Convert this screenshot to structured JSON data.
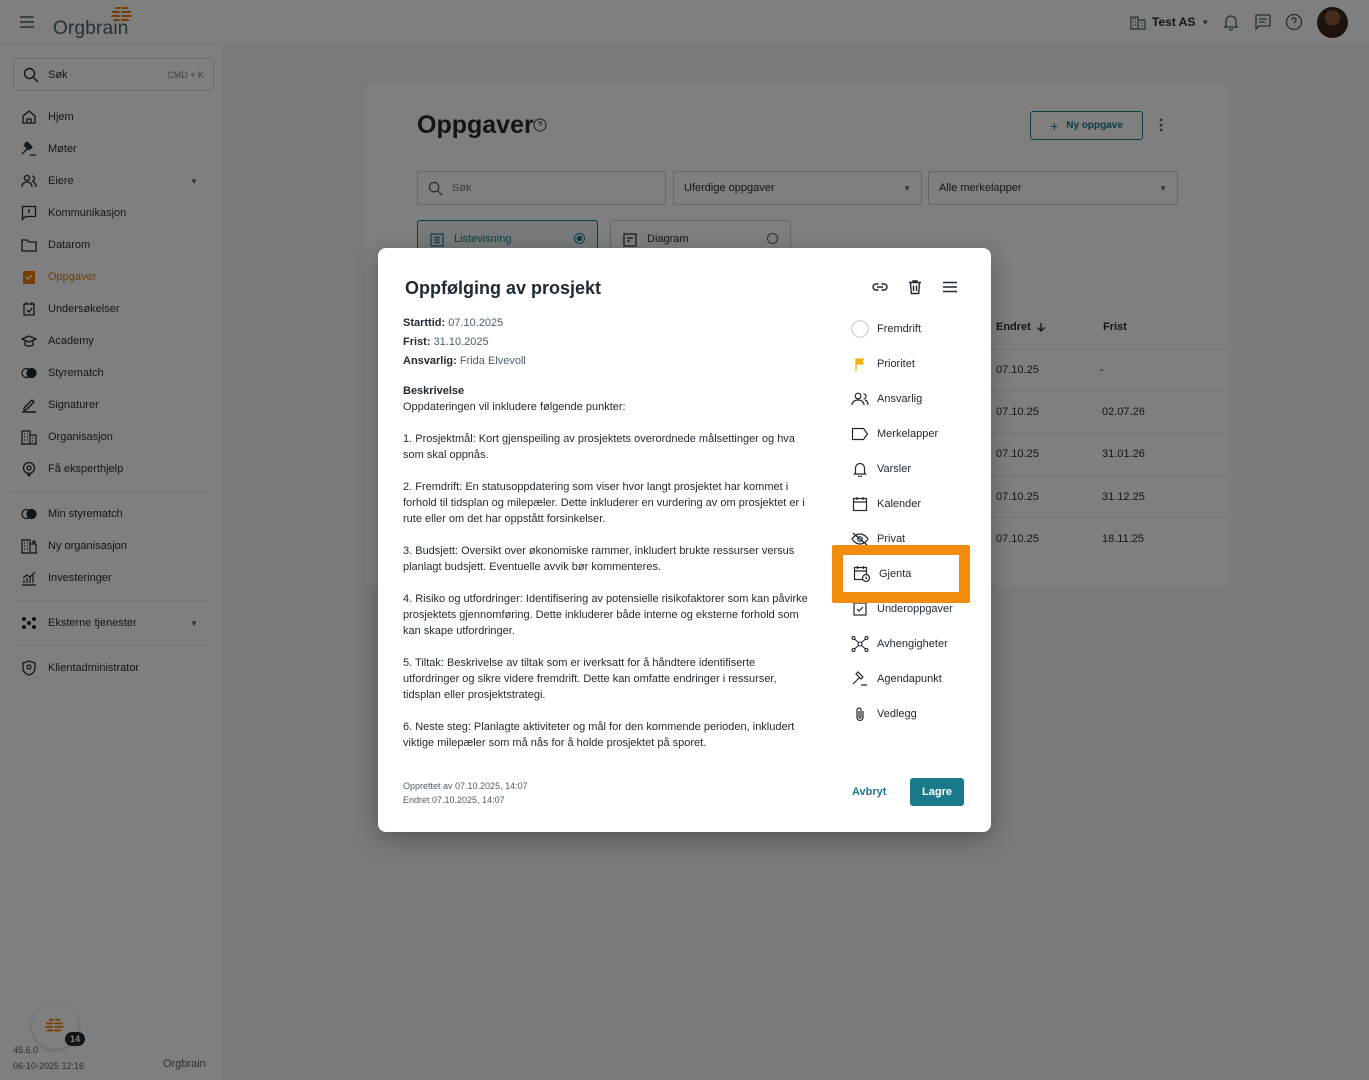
{
  "app": {
    "logo_text": "Orgbrain",
    "company": "Test AS"
  },
  "sidebar": {
    "search_label": "Søk",
    "search_shortcut": "CMD + K",
    "items": [
      {
        "label": "Hjem",
        "icon": "home-icon"
      },
      {
        "label": "Møter",
        "icon": "gavel-icon"
      },
      {
        "label": "Eiere",
        "icon": "people-icon"
      },
      {
        "label": "Kommunikasjon",
        "icon": "chat-icon"
      },
      {
        "label": "Datarom",
        "icon": "folder-icon"
      },
      {
        "label": "Oppgaver",
        "icon": "task-icon"
      },
      {
        "label": "Undersøkelser",
        "icon": "survey-icon"
      },
      {
        "label": "Academy",
        "icon": "academy-icon"
      },
      {
        "label": "Styrematch",
        "icon": "match-icon"
      },
      {
        "label": "Signaturer",
        "icon": "pen-icon"
      },
      {
        "label": "Organisasjon",
        "icon": "building-icon"
      },
      {
        "label": "Få eksperthjelp",
        "icon": "expert-icon"
      }
    ],
    "items2": [
      {
        "label": "Min styrematch",
        "icon": "match-icon"
      },
      {
        "label": "Ny organisasjon",
        "icon": "building-icon"
      },
      {
        "label": "Investeringer",
        "icon": "chart-icon"
      }
    ],
    "external": "Eksterne tjenester",
    "admin": "Klientadministrator",
    "badge_count": "14",
    "version": "45.6.0",
    "version_date": "06-10-2025 12:16",
    "footer_logo": "Orgbrain"
  },
  "page": {
    "title": "Oppgaver",
    "new_button": "Ny oppgave",
    "search_placeholder": "Søk",
    "filter_status": "Uferdige oppgaver",
    "filter_tags": "Alle merkelapper",
    "view_list": "Listevisning",
    "view_diagram": "Diagram",
    "col_changed": "Endret",
    "col_due": "Frist",
    "rows": [
      {
        "changed": "07.10.25",
        "due": "-"
      },
      {
        "changed": "07.10.25",
        "due": "02.07.26"
      },
      {
        "changed": "07.10.25",
        "due": "31.01.26"
      },
      {
        "changed": "07.10.25",
        "due": "31.12.25"
      },
      {
        "changed": "07.10.25",
        "due": "18.11.25"
      }
    ]
  },
  "dialog": {
    "title": "Oppfølging av prosjekt",
    "start_label": "Starttid:",
    "start_value": "07.10.2025",
    "due_label": "Frist:",
    "due_value": "31.10.2025",
    "resp_label": "Ansvarlig:",
    "resp_value": "Frida Elvevoll",
    "desc_heading": "Beskrivelse",
    "desc_intro": "Oppdateringen vil inkludere følgende punkter:",
    "desc_points": [
      "1. Prosjektmål: Kort gjenspeiling av prosjektets overordnede målsettinger og hva som skal oppnås.",
      "2. Fremdrift: En statusoppdatering som viser hvor langt prosjektet har kommet i forhold til tidsplan og milepæler. Dette inkluderer en vurdering av om prosjektet er i rute eller om det har oppstått forsinkelser.",
      "3. Budsjett: Oversikt over økonomiske rammer, inkludert brukte ressurser versus planlagt budsjett. Eventuelle avvik bør kommenteres.",
      "4. Risiko og utfordringer: Identifisering av potensielle risikofaktorer som kan påvirke prosjektets gjennomføring. Dette inkluderer både interne og eksterne forhold som kan skape utfordringer.",
      "5. Tiltak: Beskrivelse av tiltak som er iverksatt for å håndtere identifiserte utfordringer og sikre videre fremdrift. Dette kan omfatte endringer i ressurser, tidsplan eller prosjektstrategi.",
      "6. Neste steg: Planlagte aktiviteter og mål for den kommende perioden, inkludert viktige milepæler som må nås for å holde prosjektet på sporet."
    ],
    "created": "Opprettet av 07.10.2025, 14:07",
    "changed": "Endret 07.10.2025, 14:07",
    "side_items": [
      {
        "label": "Fremdrift",
        "icon": "progress-circle-icon"
      },
      {
        "label": "Prioritet",
        "icon": "flag-icon"
      },
      {
        "label": "Ansvarlig",
        "icon": "people-icon"
      },
      {
        "label": "Merkelapper",
        "icon": "label-icon"
      },
      {
        "label": "Varsler",
        "icon": "bell-icon"
      },
      {
        "label": "Kalender",
        "icon": "calendar-icon"
      },
      {
        "label": "Privat",
        "icon": "eye-off-icon"
      },
      {
        "label": "Gjenta",
        "icon": "repeat-calendar-icon"
      },
      {
        "label": "Underoppgaver",
        "icon": "subtask-icon"
      },
      {
        "label": "Avhengigheter",
        "icon": "dependency-icon"
      },
      {
        "label": "Agendapunkt",
        "icon": "gavel-icon"
      },
      {
        "label": "Vedlegg",
        "icon": "attachment-icon"
      }
    ],
    "cancel": "Avbryt",
    "save": "Lagre"
  },
  "colors": {
    "accent": "#1a7a8a",
    "active_nav": "#ef7d00",
    "highlight": "#f28c0c"
  }
}
